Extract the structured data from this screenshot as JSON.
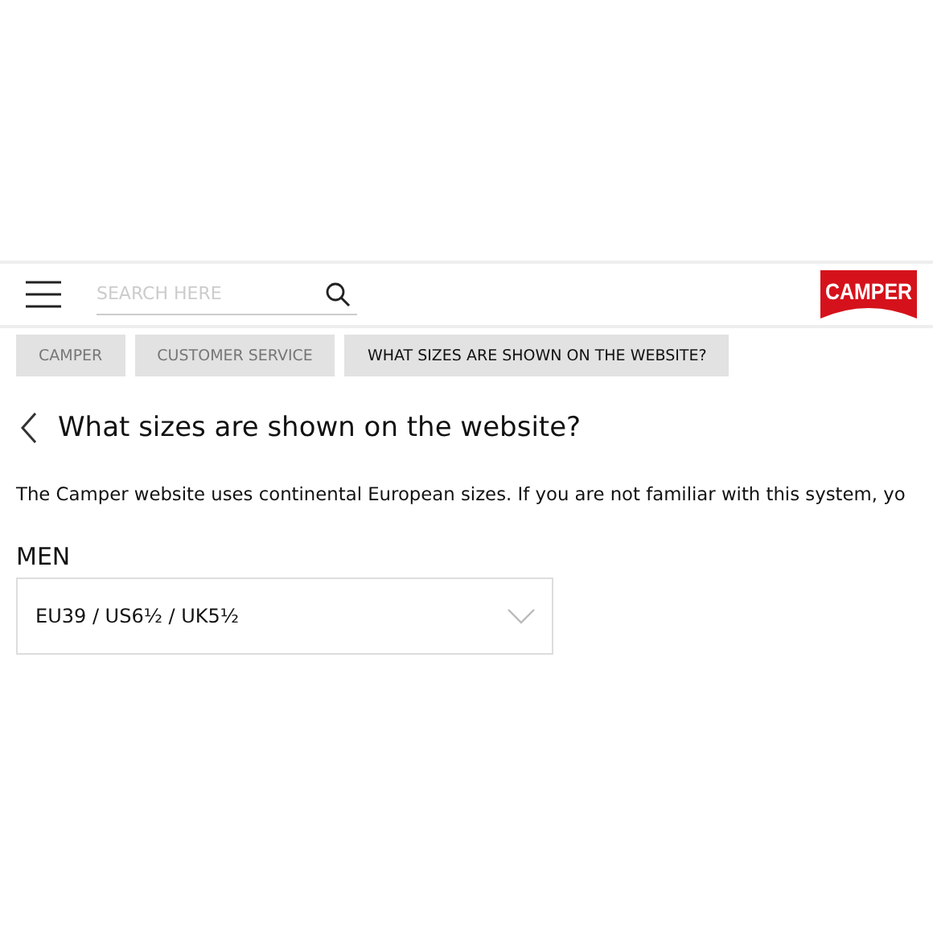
{
  "header": {
    "search": {
      "placeholder": "SEARCH HERE"
    },
    "logo": "CAMPER"
  },
  "breadcrumbs": [
    {
      "label": "CAMPER",
      "current": false
    },
    {
      "label": "CUSTOMER SERVICE",
      "current": false
    },
    {
      "label": "WHAT SIZES ARE SHOWN ON THE WEBSITE?",
      "current": true
    }
  ],
  "title": "What sizes are shown on the website?",
  "intro": "The Camper website uses continental European sizes. If you are not familiar with this system, yo",
  "size_selects": [
    {
      "label": "MEN",
      "value": "EU39 / US6½ / UK5½"
    }
  ]
}
